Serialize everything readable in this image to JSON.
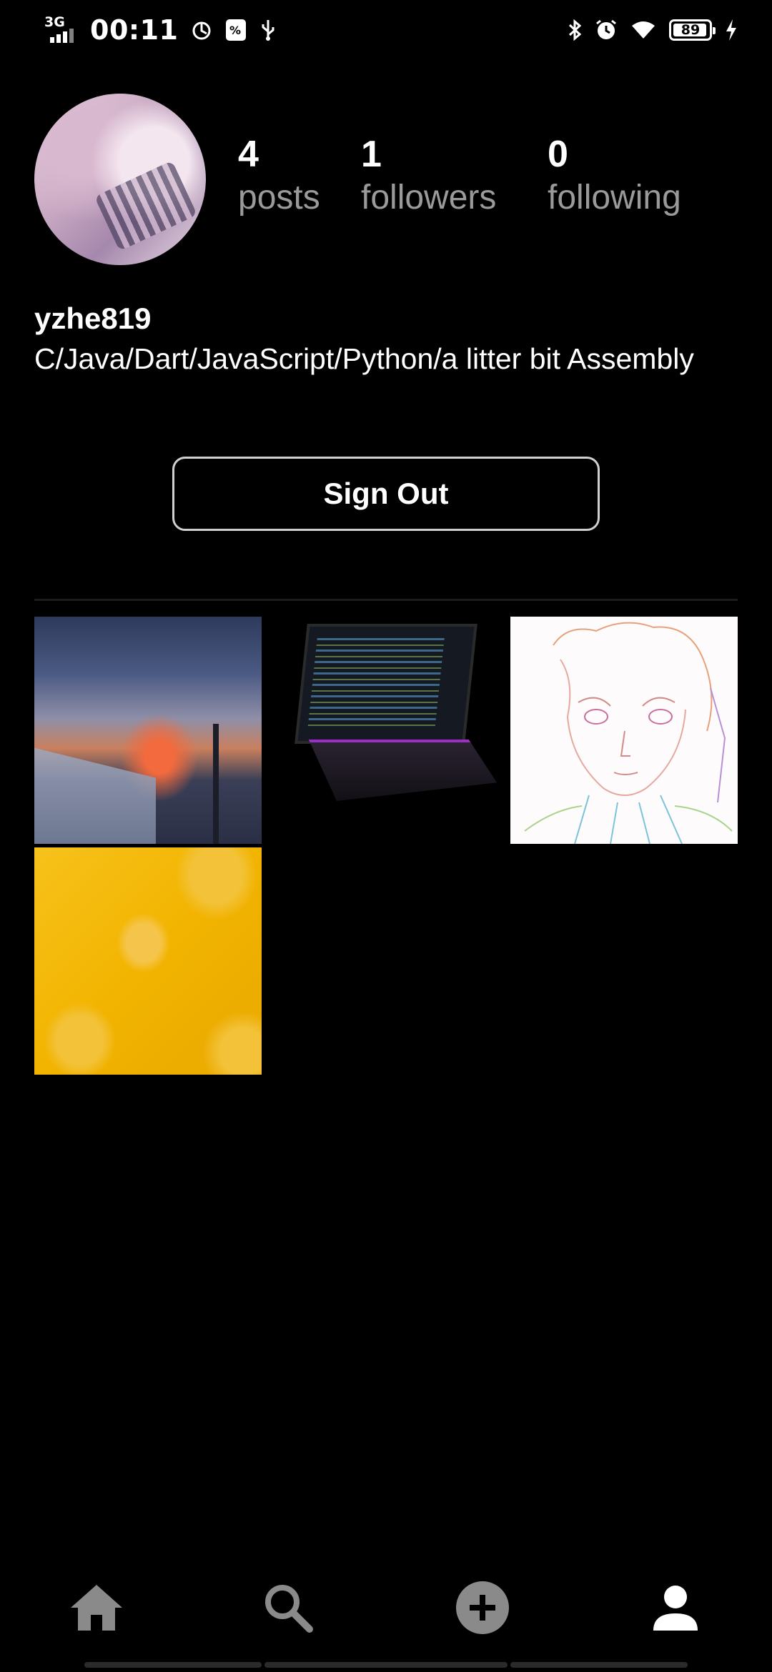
{
  "status_bar": {
    "network": "3G",
    "time": "00:11",
    "battery_level": "89"
  },
  "profile": {
    "username": "yzhe819",
    "bio": "C/Java/Dart/JavaScript/Python/a litter bit Assembly",
    "stats": [
      {
        "value": "4",
        "label": "posts"
      },
      {
        "value": "1",
        "label": "followers"
      },
      {
        "value": "0",
        "label": "following"
      }
    ],
    "sign_out_label": "Sign Out"
  },
  "posts_count": 4,
  "bottom_nav": {
    "items": [
      {
        "icon": "home-icon",
        "active": false
      },
      {
        "icon": "search-icon",
        "active": false
      },
      {
        "icon": "add-circle-icon",
        "active": false
      },
      {
        "icon": "person-icon",
        "active": true
      }
    ]
  },
  "colors": {
    "background": "#000000",
    "text_primary": "#ffffff",
    "text_secondary": "#9a9a9a",
    "nav_inactive": "#8a8a8a",
    "nav_active": "#ffffff"
  }
}
